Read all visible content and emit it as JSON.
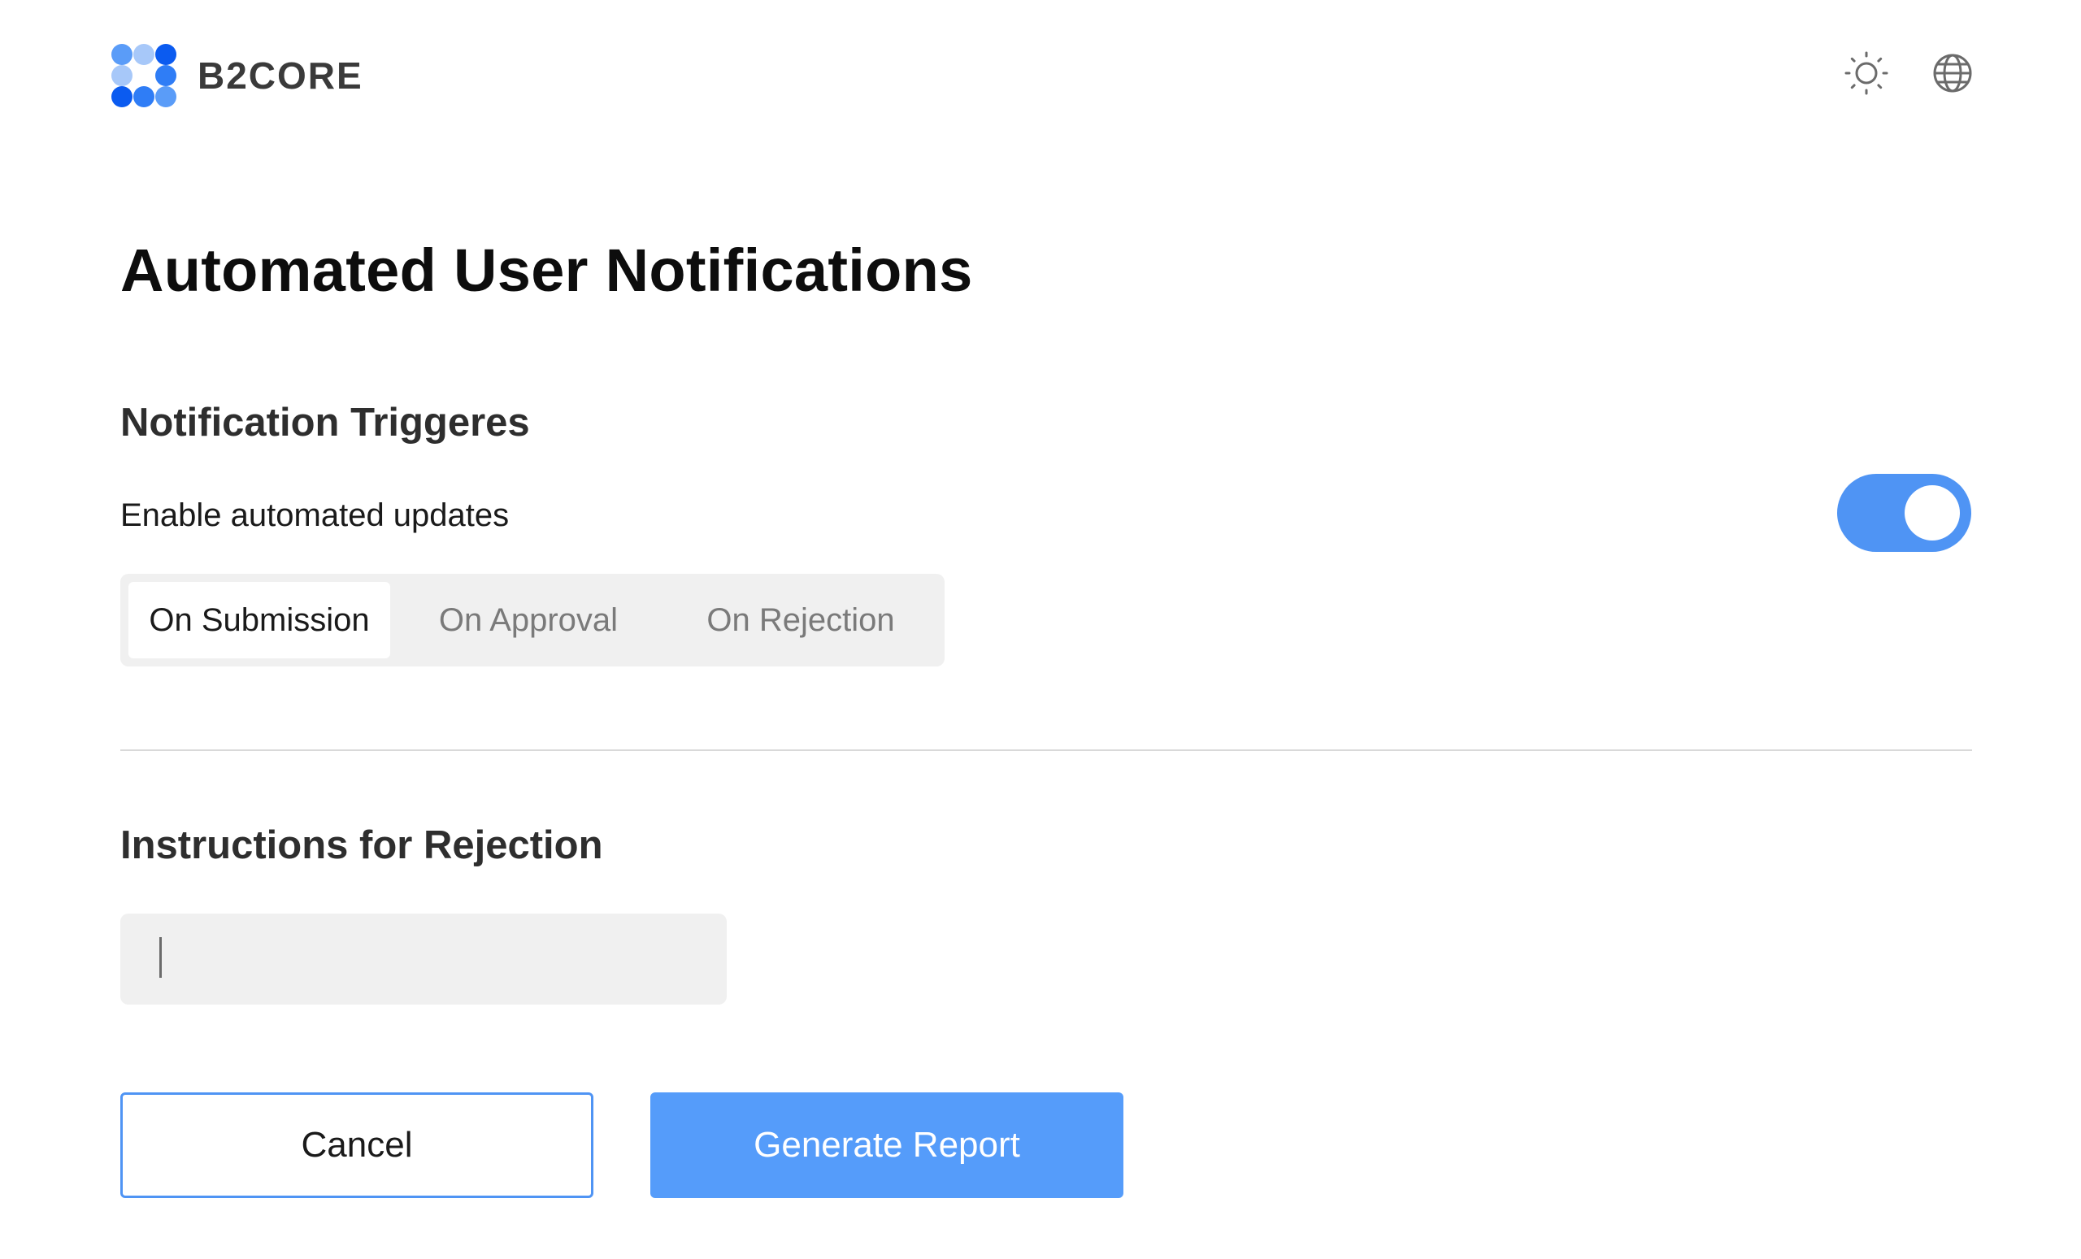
{
  "app": {
    "logo_text": "B2CORE",
    "brand_colors": [
      "#2f7df6",
      "#0b5bf0",
      "#8ab8f8"
    ]
  },
  "header": {
    "icons": [
      "sun-icon",
      "globe-icon"
    ]
  },
  "page": {
    "title": "Automated User Notifications"
  },
  "triggers": {
    "section_title": "Notification Triggeres",
    "toggle_label": "Enable automated updates",
    "toggle_on": true,
    "toggle_color": "#4f94f4",
    "options": [
      {
        "label": "On Submission",
        "selected": true
      },
      {
        "label": "On Approval",
        "selected": false
      },
      {
        "label": "On Rejection",
        "selected": false
      }
    ]
  },
  "instructions": {
    "section_title": "Instructions for Rejection",
    "value": "",
    "placeholder": ""
  },
  "actions": {
    "cancel_label": "Cancel",
    "generate_label": "Generate Report",
    "primary_color": "#559cfa"
  }
}
